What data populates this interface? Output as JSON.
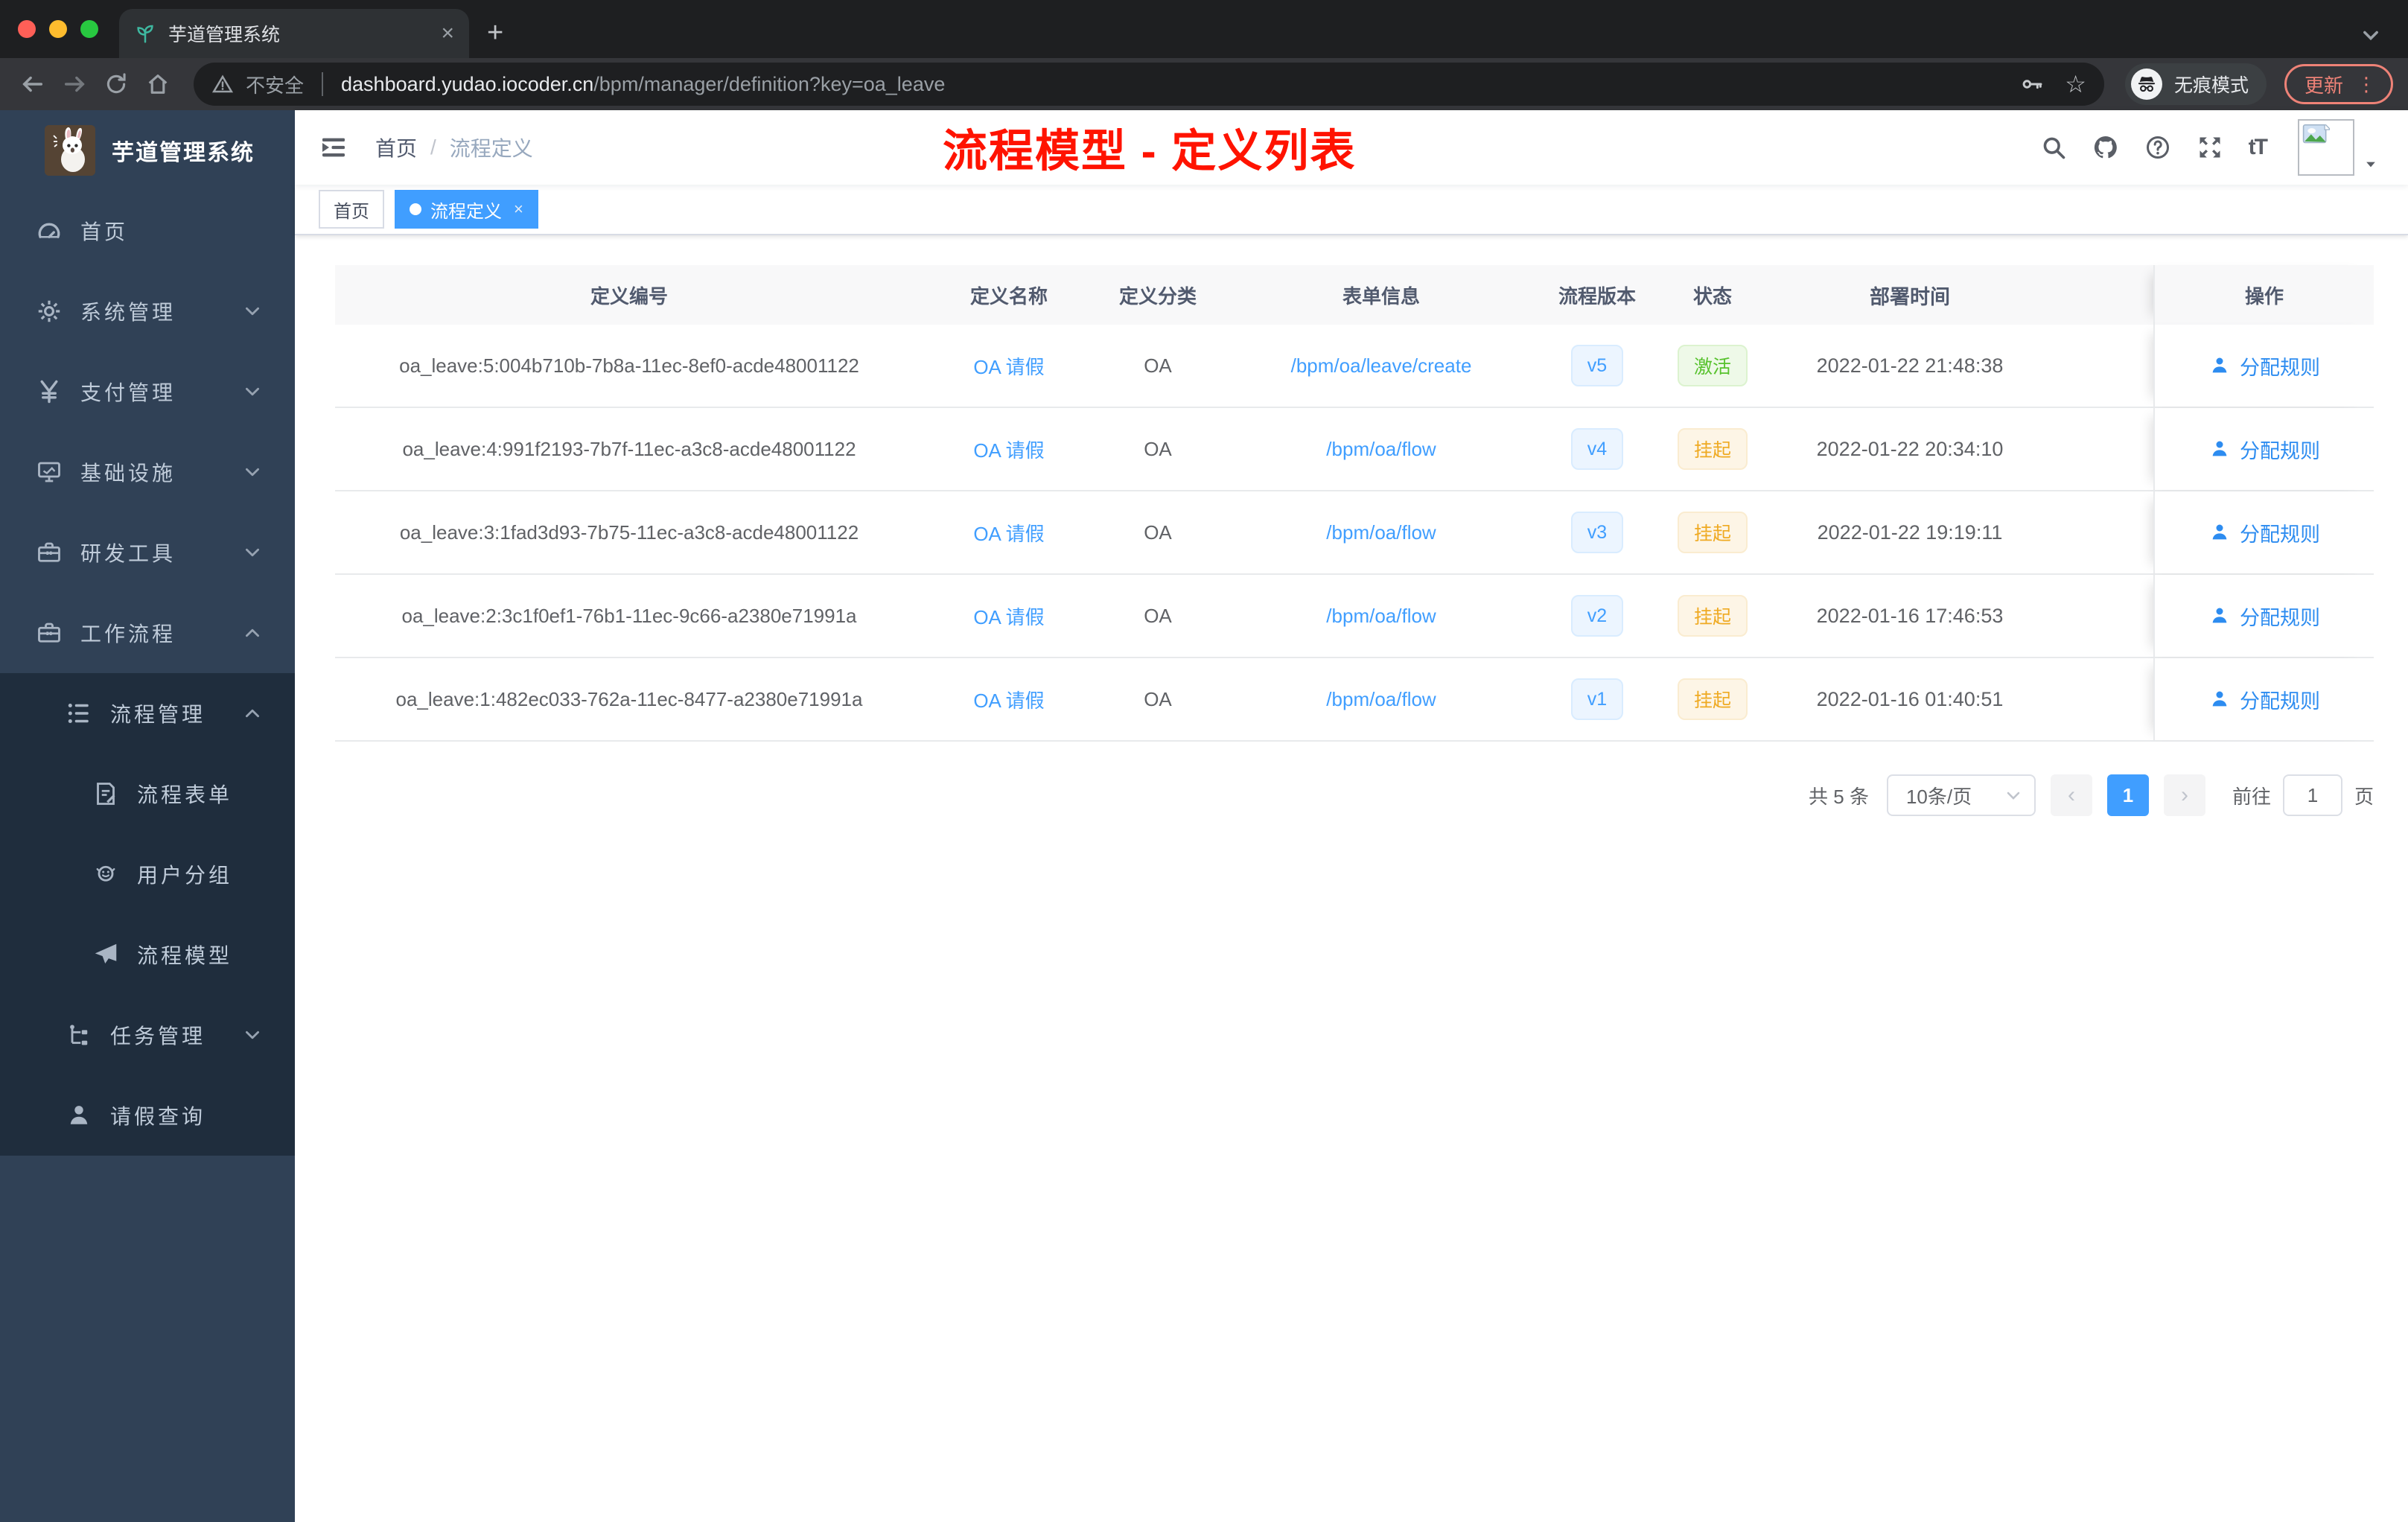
{
  "browser": {
    "tab_title": "芋道管理系统",
    "new_tab_label": "+",
    "close_tab_label": "×",
    "security_label": "不安全",
    "url_host": "dashboard.yudao.iocoder.cn",
    "url_path": "/bpm/manager/definition?key=oa_leave",
    "incognito_label": "无痕模式",
    "update_label": "更新",
    "menu_dots": "⋮"
  },
  "sidebar": {
    "logo_title": "芋道管理系统",
    "items": [
      {
        "key": "home",
        "label": "首页",
        "icon": "dashboard-icon",
        "level": 1,
        "dark": false,
        "chevron": null
      },
      {
        "key": "system",
        "label": "系统管理",
        "icon": "gear-icon",
        "level": 1,
        "dark": false,
        "chevron": "down"
      },
      {
        "key": "payment",
        "label": "支付管理",
        "icon": "yen-icon",
        "level": 1,
        "dark": false,
        "chevron": "down"
      },
      {
        "key": "infrastructure",
        "label": "基础设施",
        "icon": "monitor-icon",
        "level": 1,
        "dark": false,
        "chevron": "down"
      },
      {
        "key": "dev-tools",
        "label": "研发工具",
        "icon": "toolbox-icon",
        "level": 1,
        "dark": false,
        "chevron": "down"
      },
      {
        "key": "workflow",
        "label": "工作流程",
        "icon": "briefcase-icon",
        "level": 1,
        "dark": false,
        "chevron": "up"
      },
      {
        "key": "process-mgmt",
        "label": "流程管理",
        "icon": "list-tree-icon",
        "level": 2,
        "dark": true,
        "chevron": "up"
      },
      {
        "key": "process-form",
        "label": "流程表单",
        "icon": "form-icon",
        "level": 3,
        "dark": true,
        "chevron": null
      },
      {
        "key": "user-group",
        "label": "用户分组",
        "icon": "users-icon",
        "level": 3,
        "dark": true,
        "chevron": null
      },
      {
        "key": "process-model",
        "label": "流程模型",
        "icon": "send-icon",
        "level": 3,
        "dark": true,
        "chevron": null
      },
      {
        "key": "task-mgmt",
        "label": "任务管理",
        "icon": "tree-icon",
        "level": 2,
        "dark": true,
        "chevron": "down"
      },
      {
        "key": "leave-query",
        "label": "请假查询",
        "icon": "user-icon",
        "level": 2,
        "dark": true,
        "chevron": null
      }
    ]
  },
  "header": {
    "breadcrumb": [
      "首页",
      "流程定义"
    ],
    "breadcrumb_separator": "/",
    "annotation": "流程模型 - 定义列表",
    "annotation_color": "#ff1300",
    "action_icons": [
      "search-icon",
      "github-icon",
      "question-icon",
      "fullscreen-icon",
      "font-size-icon"
    ],
    "font_size_icon_label": "tT"
  },
  "tags": [
    {
      "label": "首页",
      "active": false
    },
    {
      "label": "流程定义",
      "active": true,
      "closable": true,
      "close_label": "×"
    }
  ],
  "table": {
    "columns": [
      "定义编号",
      "定义名称",
      "定义分类",
      "表单信息",
      "流程版本",
      "状态",
      "部署时间",
      "操作"
    ],
    "rows": [
      {
        "id": "oa_leave:5:004b710b-7b8a-11ec-8ef0-acde48001122",
        "name": "OA 请假",
        "category": "OA",
        "form": "/bpm/oa/leave/create",
        "version": "v5",
        "status": "激活",
        "status_type": "success",
        "deploy_time": "2022-01-22 21:48:38",
        "action": "分配规则"
      },
      {
        "id": "oa_leave:4:991f2193-7b7f-11ec-a3c8-acde48001122",
        "name": "OA 请假",
        "category": "OA",
        "form": "/bpm/oa/flow",
        "version": "v4",
        "status": "挂起",
        "status_type": "warning",
        "deploy_time": "2022-01-22 20:34:10",
        "action": "分配规则"
      },
      {
        "id": "oa_leave:3:1fad3d93-7b75-11ec-a3c8-acde48001122",
        "name": "OA 请假",
        "category": "OA",
        "form": "/bpm/oa/flow",
        "version": "v3",
        "status": "挂起",
        "status_type": "warning",
        "deploy_time": "2022-01-22 19:19:11",
        "action": "分配规则"
      },
      {
        "id": "oa_leave:2:3c1f0ef1-76b1-11ec-9c66-a2380e71991a",
        "name": "OA 请假",
        "category": "OA",
        "form": "/bpm/oa/flow",
        "version": "v2",
        "status": "挂起",
        "status_type": "warning",
        "deploy_time": "2022-01-16 17:46:53",
        "action": "分配规则"
      },
      {
        "id": "oa_leave:1:482ec033-762a-11ec-8477-a2380e71991a",
        "name": "OA 请假",
        "category": "OA",
        "form": "/bpm/oa/flow",
        "version": "v1",
        "status": "挂起",
        "status_type": "warning",
        "deploy_time": "2022-01-16 01:40:51",
        "action": "分配规则"
      }
    ]
  },
  "pagination": {
    "total": "共 5 条",
    "page_size": "10条/页",
    "prev_label": "‹",
    "next_label": "›",
    "current_page": "1",
    "goto_label": "前往",
    "goto_value": "1",
    "unit_label": "页"
  },
  "colors": {
    "accent_blue": "#409eff",
    "sidebar_bg": "#304156",
    "sidebar_submenu_bg": "#1f2d3d",
    "status_active_green": "#57c22d",
    "status_suspend_orange": "#efaa22"
  }
}
